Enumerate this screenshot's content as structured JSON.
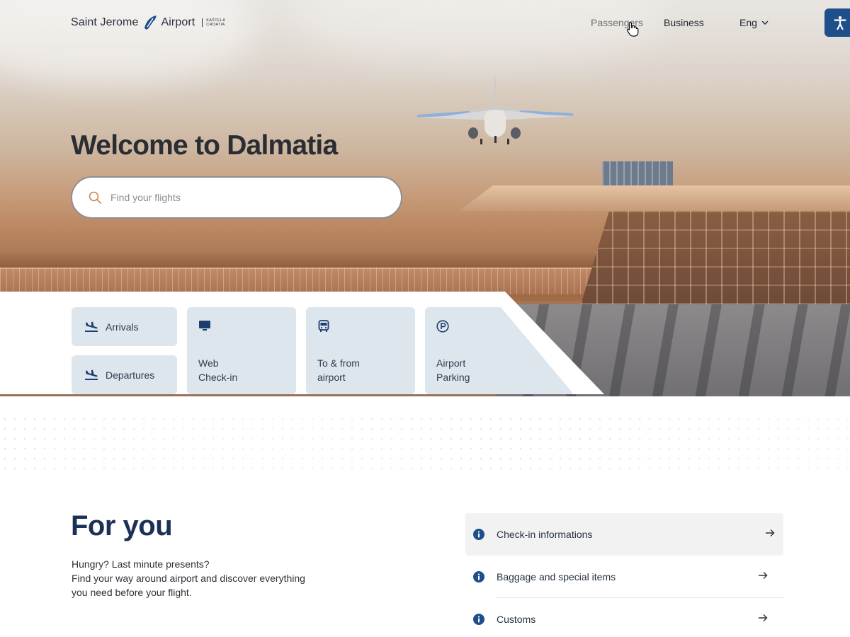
{
  "header": {
    "logo": {
      "name_left": "Saint Jerome",
      "name_right": "Airport",
      "sub_line1": "KAŠTELA",
      "sub_line2": "CROATIA"
    },
    "nav": [
      {
        "label": "Passengers"
      },
      {
        "label": "Business"
      },
      {
        "label": "Eng"
      }
    ]
  },
  "hero": {
    "title": "Welcome to Dalmatia",
    "search_placeholder": "Find your flights"
  },
  "quick_links": {
    "arrivals": "Arrivals",
    "departures": "Departures",
    "web_checkin": [
      "Web",
      "Check-in"
    ],
    "to_from_airport": [
      "To & from",
      "airport"
    ],
    "airport_parking": [
      "Airport",
      "Parking"
    ]
  },
  "for_you": {
    "title": "For you",
    "text": [
      "Hungry? Last minute presents?",
      "Find your way around airport and discover everything",
      "you need before your flight."
    ],
    "items": [
      {
        "label": "Check-in informations"
      },
      {
        "label": "Baggage and special items"
      },
      {
        "label": "Customs"
      }
    ]
  },
  "colors": {
    "brand_blue": "#1e4f8a",
    "tile_bg": "#dde5ed",
    "title_navy": "#1b3256"
  }
}
